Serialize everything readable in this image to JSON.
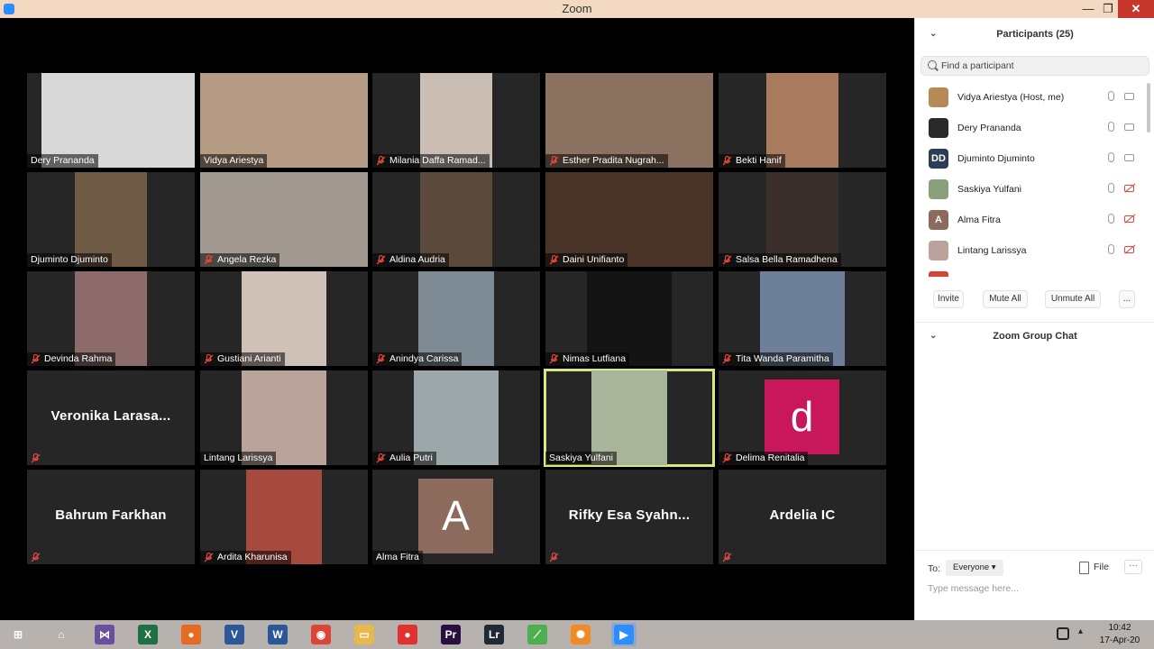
{
  "window": {
    "title": "Zoom",
    "minimize": "—",
    "maximize": "❐",
    "close": "✕"
  },
  "tiles": [
    {
      "name": "Dery Prananda",
      "muted": false,
      "kind": "photo",
      "photo": "#d8d8d8",
      "photo_w": 170,
      "photo_l": 16
    },
    {
      "name": "Vidya Ariestya",
      "muted": false,
      "kind": "photo",
      "photo": "#b69b84",
      "photo_w": 186,
      "photo_l": 0
    },
    {
      "name": "Milania Daffa Ramad...",
      "muted": true,
      "kind": "photo",
      "photo": "#c9bdb4",
      "photo_w": 80,
      "photo_l": 53
    },
    {
      "name": "Esther Pradita Nugrah...",
      "muted": true,
      "kind": "photo",
      "photo": "#8a7160",
      "photo_w": 186,
      "photo_l": 0
    },
    {
      "name": "Bekti Hanif",
      "muted": true,
      "kind": "photo",
      "photo": "#a87a5e",
      "photo_w": 80,
      "photo_l": 53
    },
    {
      "name": "Djuminto Djuminto",
      "muted": false,
      "kind": "photo",
      "photo": "#6f5a45",
      "photo_w": 80,
      "photo_l": 53
    },
    {
      "name": "Angela Rezka",
      "muted": true,
      "kind": "photo",
      "photo": "#a29a90",
      "photo_w": 186,
      "photo_l": 0
    },
    {
      "name": "Aldina Audria",
      "muted": true,
      "kind": "photo",
      "photo": "#5b4a3c",
      "photo_w": 80,
      "photo_l": 53
    },
    {
      "name": "Daini Unifianto",
      "muted": true,
      "kind": "photo",
      "photo": "#4a3428",
      "photo_w": 186,
      "photo_l": 0
    },
    {
      "name": "Salsa Bella Ramadhena",
      "muted": true,
      "kind": "photo",
      "photo": "#3a2f2a",
      "photo_w": 80,
      "photo_l": 53
    },
    {
      "name": "Devinda Rahma",
      "muted": true,
      "kind": "photo",
      "photo": "#8d6b6b",
      "photo_w": 80,
      "photo_l": 53
    },
    {
      "name": "Gustiani Arianti",
      "muted": true,
      "kind": "photo",
      "photo": "#cfc0b8",
      "photo_w": 94,
      "photo_l": 46
    },
    {
      "name": "Anindya Carissa",
      "muted": true,
      "kind": "photo",
      "photo": "#7e8b94",
      "photo_w": 84,
      "photo_l": 51
    },
    {
      "name": "Nimas Lutfiana",
      "muted": true,
      "kind": "photo",
      "photo": "#141414",
      "photo_w": 94,
      "photo_l": 46
    },
    {
      "name": "Tita Wanda Paramitha",
      "muted": true,
      "kind": "photo",
      "photo": "#6e7f9a",
      "photo_w": 94,
      "photo_l": 46
    },
    {
      "name": "",
      "big": "Veronika Larasa...",
      "muted": true,
      "kind": "name"
    },
    {
      "name": "Lintang Larissya",
      "muted": false,
      "kind": "photo",
      "photo": "#b9a39a",
      "photo_w": 94,
      "photo_l": 46
    },
    {
      "name": "Aulia Putri",
      "muted": true,
      "kind": "photo",
      "photo": "#9ba7a9",
      "photo_w": 94,
      "photo_l": 46
    },
    {
      "name": "Saskiya Yulfani",
      "muted": false,
      "kind": "photo",
      "photo": "#a9b59a",
      "photo_w": 84,
      "photo_l": 51,
      "active": true
    },
    {
      "name": "Delima Renitalia",
      "muted": true,
      "kind": "letter",
      "letter": "d",
      "color": "#c8175a"
    },
    {
      "name": "",
      "big": "Bahrum Farkhan",
      "muted": true,
      "kind": "name"
    },
    {
      "name": "Ardita Kharunisa",
      "muted": true,
      "kind": "photo",
      "photo": "#a64a3f",
      "photo_w": 84,
      "photo_l": 51
    },
    {
      "name": "Alma Fitra",
      "muted": false,
      "kind": "letter",
      "letter": "A",
      "color": "#8c6a5c"
    },
    {
      "name": "",
      "big": "Rifky Esa Syahn...",
      "muted": true,
      "kind": "name"
    },
    {
      "name": "",
      "big": "Ardelia IC",
      "muted": true,
      "kind": "name"
    }
  ],
  "panel": {
    "participants_title": "Participants (25)",
    "search_placeholder": "Find a participant",
    "participants": [
      {
        "name": "Vidya Ariestya (Host, me)",
        "avatar": "",
        "color": "#b58a55",
        "video_off": false
      },
      {
        "name": "Dery Prananda",
        "avatar": "",
        "color": "#2a2a2a",
        "video_off": false
      },
      {
        "name": "Djuminto Djuminto",
        "avatar": "DD",
        "color": "#2c3e55",
        "video_off": false
      },
      {
        "name": "Saskiya Yulfani",
        "avatar": "",
        "color": "#8aa07a",
        "video_off": true
      },
      {
        "name": "Alma Fitra",
        "avatar": "A",
        "color": "#8c6a5c",
        "video_off": true
      },
      {
        "name": "Lintang Larissya",
        "avatar": "",
        "color": "#b9a39a",
        "video_off": true
      }
    ],
    "buttons": {
      "invite": "Invite",
      "mute_all": "Mute All",
      "unmute_all": "Unmute All",
      "more": "..."
    },
    "chat_title": "Zoom Group Chat",
    "chat": {
      "to_label": "To:",
      "recipient": "Everyone ▾",
      "file": "File",
      "more": "···",
      "placeholder": "Type message here..."
    }
  },
  "taskbar": {
    "apps": [
      {
        "name": "start",
        "glyph": "⊞",
        "color": "transparent"
      },
      {
        "name": "home",
        "glyph": "⌂",
        "color": "transparent"
      },
      {
        "name": "visual-studio",
        "glyph": "⋈",
        "color": "#6a4fa0"
      },
      {
        "name": "excel",
        "glyph": "X",
        "color": "#1e7145"
      },
      {
        "name": "firefox",
        "glyph": "●",
        "color": "#e66a1f"
      },
      {
        "name": "visio",
        "glyph": "V",
        "color": "#2b5797"
      },
      {
        "name": "word",
        "glyph": "W",
        "color": "#2b579a"
      },
      {
        "name": "chrome",
        "glyph": "◉",
        "color": "#db4437"
      },
      {
        "name": "file-explorer",
        "glyph": "▭",
        "color": "#e8b84a"
      },
      {
        "name": "app-red",
        "glyph": "●",
        "color": "#e0312f"
      },
      {
        "name": "premiere",
        "glyph": "Pr",
        "color": "#2a0f3e"
      },
      {
        "name": "lightroom",
        "glyph": "Lr",
        "color": "#1f2a36"
      },
      {
        "name": "app-green",
        "glyph": "⟋",
        "color": "#4caf50"
      },
      {
        "name": "app-orange",
        "glyph": "✺",
        "color": "#f08a24"
      },
      {
        "name": "zoom",
        "glyph": "▶",
        "color": "#2d8cff"
      }
    ],
    "time": "10:42",
    "date": "17-Apr-20"
  }
}
